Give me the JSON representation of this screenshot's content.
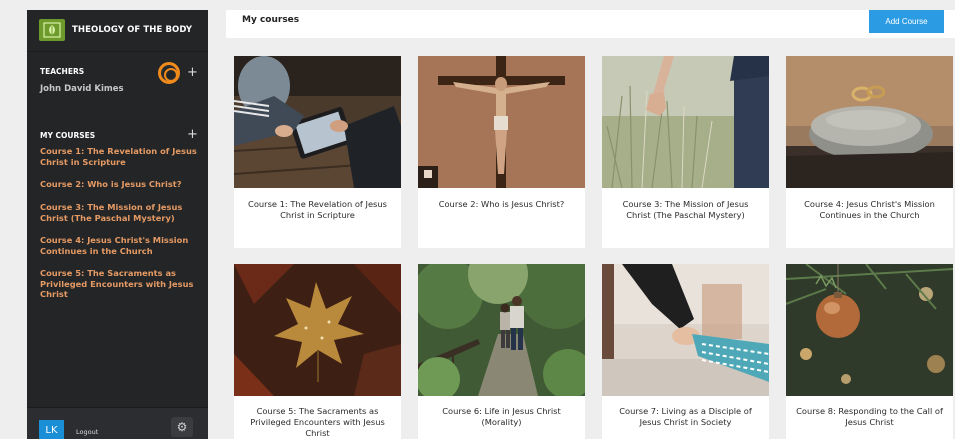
{
  "brand": {
    "title": "THEOLOGY OF THE BODY"
  },
  "teachers": {
    "heading": "TEACHERS",
    "name": "John David Kimes"
  },
  "sidebar_courses": {
    "heading": "MY COURSES",
    "items": [
      "Course 1: The Revelation of Jesus Christ in Scripture",
      "Course 2: Who is Jesus Christ?",
      "Course 3: The Mission of Jesus Christ (The Paschal Mystery)",
      "Course 4: Jesus Christ's Mission Continues in the Church",
      "Course 5: The Sacraments as Privileged Encounters with Jesus Christ"
    ]
  },
  "footer": {
    "avatar_initials": "LK",
    "logout_label": "Logout",
    "settings_icon": "gear-icon"
  },
  "main": {
    "title": "My courses",
    "add_button": "Add Course"
  },
  "cards": [
    {
      "title": "Course 1: The Revelation of Jesus Christ in Scripture"
    },
    {
      "title": "Course 2: Who is Jesus Christ?"
    },
    {
      "title": "Course 3: The Mission of Jesus Christ (The Paschal Mystery)"
    },
    {
      "title": "Course 4: Jesus Christ's Mission Continues in the Church"
    },
    {
      "title": "Course 5: The Sacraments as Privileged Encounters with Jesus Christ"
    },
    {
      "title": "Course 6: Life in Jesus Christ (Morality)"
    },
    {
      "title": "Course 7: Living as a Disciple of Jesus Christ in Society"
    },
    {
      "title": "Course 8: Responding to the Call of Jesus Christ"
    }
  ],
  "colors": {
    "sidebar_bg": "#232527",
    "link": "#e59a64",
    "accent_orange": "#f08a1c",
    "button_blue": "#2b9ce4",
    "logo_green": "#6e9a2c"
  }
}
